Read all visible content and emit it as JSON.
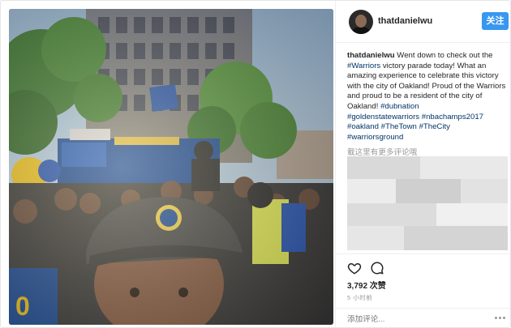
{
  "post": {
    "username": "thatdanielwu",
    "follow_label": "关注",
    "caption": {
      "user": "thatdanielwu",
      "text_1": " Went down to check out the ",
      "tag_warriors": "#Warriors",
      "text_2": " victory parade today! What an amazing experience to celebrate this victory with the city of Oakland! Proud of the Warriors and proud to be a resident of the city of Oakland! ",
      "tag_dubnation": "#dubnation",
      "tag_gsw": "#goldenstatewarriors",
      "tag_champs": "#nbachamps2017",
      "tag_oakland": "#oakland",
      "tag_thetown": "#TheTown",
      "tag_thecity": "#TheCity",
      "tag_ground": "#warriorsground"
    },
    "more_comments": "載这里有更多评论哦",
    "likes": "3,792 次赞",
    "time": "5 小时前",
    "comment_placeholder": "添加评论..."
  },
  "icons": {
    "like": "heart-icon",
    "comment": "comment-icon",
    "options": "more-options-icon"
  },
  "colors": {
    "follow_button": "#3897f0",
    "hashtag": "#003569",
    "muted": "#999999"
  }
}
